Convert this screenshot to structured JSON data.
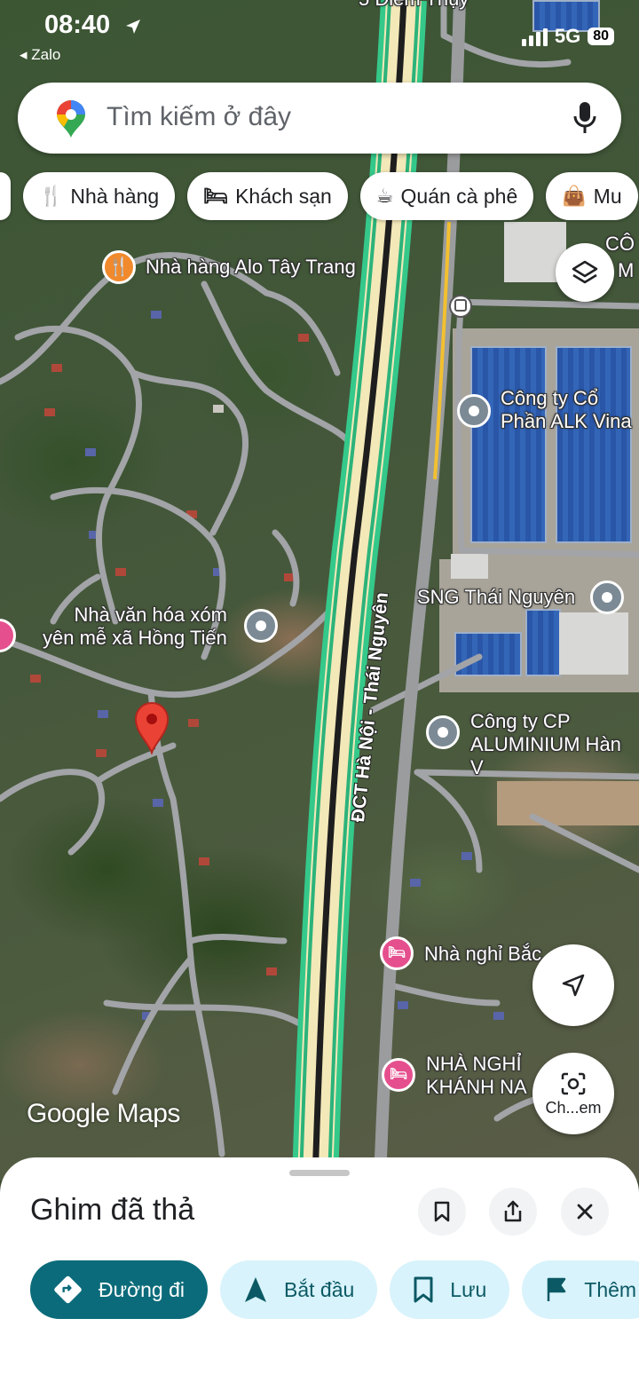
{
  "status_bar": {
    "time": "08:40",
    "back_app": "◂ Zalo",
    "network": "5G",
    "battery": "80"
  },
  "search": {
    "placeholder": "Tìm kiếm ở đây"
  },
  "chips": [
    {
      "label": "Nhà hàng",
      "icon": "restaurant-icon"
    },
    {
      "label": "Khách sạn",
      "icon": "hotel-icon"
    },
    {
      "label": "Quán cà phê",
      "icon": "coffee-icon"
    },
    {
      "label": "Mu",
      "icon": "shopping-bag-icon"
    }
  ],
  "map": {
    "top_partial_label": "5 Điểm Thụy",
    "top_right_partial": [
      "CÔ",
      "M"
    ],
    "road_name": "ĐCT Hà Nội - Thái Nguyên",
    "pois": [
      {
        "name": "Nhà hàng Alo Tây Trang",
        "type": "restaurant"
      },
      {
        "name": "Công ty Cổ\nPhần ALK Vina",
        "type": "place"
      },
      {
        "name": "SNG Thái Nguyên",
        "type": "place"
      },
      {
        "name": "Nhà văn hóa xóm\nyên mễ xã Hồng Tiến",
        "type": "place"
      },
      {
        "name": "Công ty CP\nALUMINIUM Hàn V",
        "type": "place"
      },
      {
        "name": "Nhà nghỉ Bắc",
        "type": "hotel"
      },
      {
        "name": "NHÀ NGHỈ\nKHÁNH NA",
        "type": "hotel"
      }
    ],
    "camera_button_label": "Ch...em",
    "attribution": "Google Maps"
  },
  "sheet": {
    "title": "Ghim đã thả",
    "actions": [
      {
        "label": "Đường đi"
      },
      {
        "label": "Bắt đầu"
      },
      {
        "label": "Lưu"
      },
      {
        "label": "Thêm"
      }
    ]
  }
}
